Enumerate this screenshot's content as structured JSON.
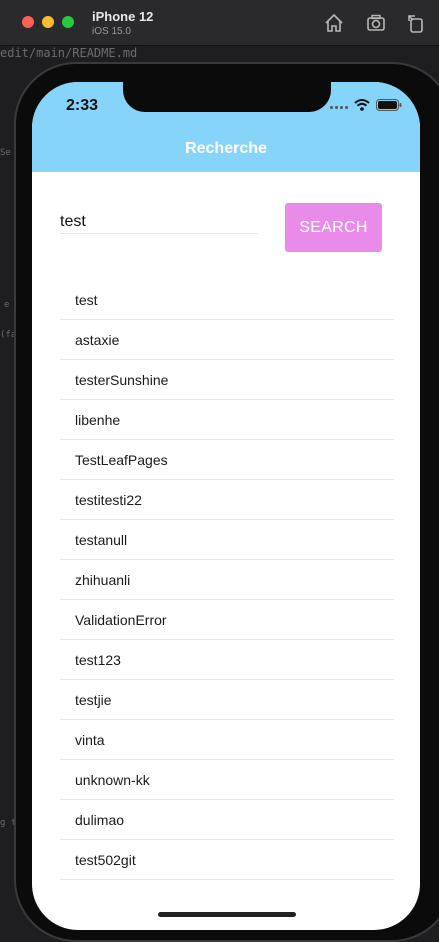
{
  "simulator": {
    "device_name": "iPhone 12",
    "os_version": "iOS 15.0",
    "tools": [
      "home-icon",
      "screenshot-icon",
      "rotate-icon"
    ]
  },
  "background": {
    "path_text": "edit/main/README.md",
    "fragments": [
      "Se",
      "e",
      "(fa",
      "g t"
    ]
  },
  "status_bar": {
    "time": "2:33"
  },
  "header": {
    "title": "Recherche",
    "color": "#87d4fb"
  },
  "search": {
    "input_value": "test",
    "button_label": "SEARCH",
    "button_color": "#e98be9"
  },
  "results": [
    "test",
    "astaxie",
    "testerSunshine",
    "libenhe",
    "TestLeafPages",
    "testitesti22",
    "testanull",
    "zhihuanli",
    "ValidationError",
    "test123",
    "testjie",
    "vinta",
    "unknown-kk",
    "dulimao",
    "test502git"
  ]
}
